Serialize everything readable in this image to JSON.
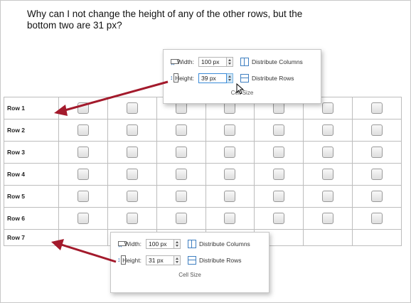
{
  "question": "Why can I not change the height of any of the other rows, but the bottom two are 31 px?",
  "table": {
    "rows": [
      "Row 1",
      "Row 2",
      "Row 3",
      "Row 4",
      "Row 5",
      "Row 6",
      "Row 7"
    ],
    "checkbox_columns": 7
  },
  "panel_top": {
    "width_label": "Width:",
    "width_value": "100 px",
    "height_label": "Height:",
    "height_value": "39 px",
    "distribute_columns": "Distribute Columns",
    "distribute_rows": "Distribute Rows",
    "section_label": "Cell Size"
  },
  "panel_bottom": {
    "width_label": "Width:",
    "width_value": "100 px",
    "height_label": "Height:",
    "height_value": "31 px",
    "distribute_columns": "Distribute Columns",
    "distribute_rows": "Distribute Rows",
    "section_label": "Cell Size"
  },
  "colors": {
    "arrow": "#a31a2c",
    "focus": "#3b8bd8"
  }
}
